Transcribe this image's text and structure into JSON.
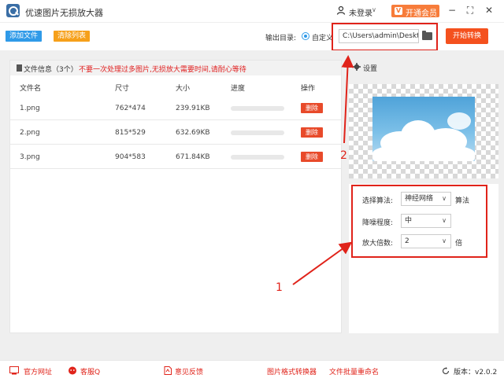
{
  "titlebar": {
    "app_title": "优速图片无损放大器",
    "login_text": "未登录",
    "login_caret": "∨",
    "vip_icon": "V",
    "vip_label": "开通会员",
    "minimize": "−",
    "maximize": "⛶",
    "close": "✕"
  },
  "toolbar": {
    "add_file": "添加文件",
    "clear_list": "清除列表",
    "output_label": "输出目录:",
    "custom_label": "自定义",
    "output_path": "C:\\Users\\admin\\Deskto",
    "start_button": "开始转换"
  },
  "file_panel": {
    "info_label": "文件信息（3个）",
    "warning": "不要一次处理过多图片,无损放大需要时间,请耐心等待",
    "columns": [
      "文件名",
      "尺寸",
      "大小",
      "进度",
      "操作"
    ],
    "rows": [
      {
        "name": "1.png",
        "dimensions": "762*474",
        "size": "239.91KB",
        "progress": 0,
        "action": "删除"
      },
      {
        "name": "2.png",
        "dimensions": "815*529",
        "size": "632.69KB",
        "progress": 0,
        "action": "删除"
      },
      {
        "name": "3.png",
        "dimensions": "904*583",
        "size": "671.84KB",
        "progress": 0,
        "action": "删除"
      }
    ]
  },
  "settings": {
    "title": "设置",
    "algorithm_label": "选择算法:",
    "algorithm_value": "神经网络",
    "algorithm_suffix": "算法",
    "denoise_label": "降噪程度:",
    "denoise_value": "中",
    "scale_label": "放大倍数:",
    "scale_value": "2",
    "scale_suffix": "倍"
  },
  "annotations": {
    "label_1": "1",
    "label_2": "2",
    "color": "#e0231a"
  },
  "footer": {
    "website": "官方网址",
    "support": "客服Q",
    "feedback": "意见反馈",
    "format_converter": "图片格式转换器",
    "batch_rename": "文件批量重命名",
    "version": "版本：v2.0.2"
  },
  "colors": {
    "accent_blue": "#2f9ae8",
    "accent_orange": "#f6a01a",
    "start_button": "#f4511e",
    "delete_button": "#e84a2a",
    "vip": "#f77c3a"
  },
  "icons": [
    "app-logo-icon",
    "user-icon",
    "folder-icon",
    "document-icon",
    "gear-icon",
    "website-icon",
    "support-icon",
    "pdf-icon",
    "refresh-icon"
  ]
}
